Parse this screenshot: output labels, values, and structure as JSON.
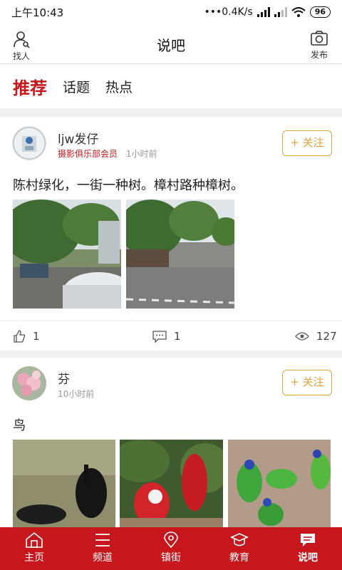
{
  "status_bar": {
    "time": "上午10:43",
    "network": "•••0.4K/s",
    "battery": "96"
  },
  "header": {
    "title": "说吧",
    "left_label": "找人",
    "right_label": "发布"
  },
  "tabs": [
    {
      "label": "推荐",
      "active": true
    },
    {
      "label": "话题",
      "active": false
    },
    {
      "label": "热点",
      "active": false
    }
  ],
  "posts": [
    {
      "username": "ljw发仔",
      "badge": "摄影俱乐部会员",
      "time": "1小时前",
      "follow_label": "+ 关注",
      "text": "陈村绿化，一街一种树。樟村路种樟树。",
      "likes": "1",
      "comments": "1",
      "views": "127"
    },
    {
      "username": "芬",
      "time": "10小时前",
      "follow_label": "+ 关注",
      "text": "鸟"
    }
  ],
  "bottom_nav": [
    {
      "label": "主页",
      "icon": "home-icon"
    },
    {
      "label": "频道",
      "icon": "list-icon"
    },
    {
      "label": "镇街",
      "icon": "location-icon"
    },
    {
      "label": "教育",
      "icon": "graduation-cap-icon"
    },
    {
      "label": "说吧",
      "icon": "chat-bubble-icon",
      "active": true
    }
  ],
  "colors": {
    "brand": "#c8161d",
    "follow": "#e6a23c"
  }
}
